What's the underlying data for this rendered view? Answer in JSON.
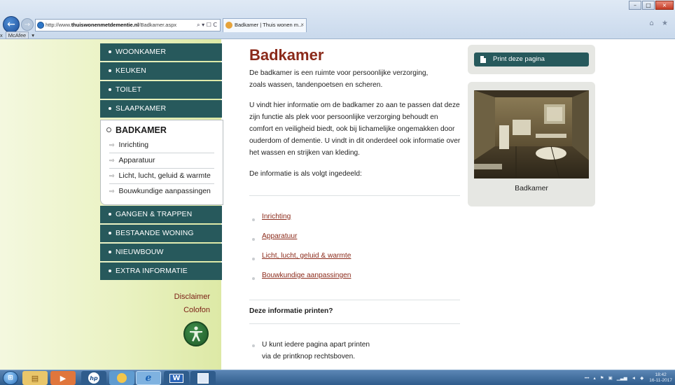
{
  "browser": {
    "url_prefix": "http://www.",
    "url_domain": "thuiswonenmetdementie.nl",
    "url_path": "/Badkamer.aspx",
    "address_tools": "⌕ ▾ ☐ C",
    "tab_title": "Badkamer | Thuis wonen m...",
    "tab_close": "×",
    "toolbar_close": "x",
    "toolbar_mcafee": "McAfee",
    "window_buttons": [
      "–",
      "□",
      "×"
    ],
    "home_star": "⌂ ★"
  },
  "sidebar": {
    "menu_top": [
      "WOONKAMER",
      "KEUKEN",
      "TOILET",
      "SLAAPKAMER"
    ],
    "active_section": "BADKAMER",
    "submenu": [
      "Inrichting",
      "Apparatuur",
      "Licht, lucht, geluid & warmte",
      "Bouwkundige aanpassingen"
    ],
    "menu_bottom": [
      "GANGEN & TRAPPEN",
      "BESTAANDE WONING",
      "NIEUWBOUW",
      "EXTRA INFORMATIE"
    ],
    "disclaimer": "Disclaimer",
    "colofon": "Colofon"
  },
  "content": {
    "title": "Badkamer",
    "intro": "De badkamer is een ruimte voor persoonlijke verzorging, zoals wassen, tandenpoetsen en scheren.",
    "body": "U vindt hier informatie om de badkamer zo aan te passen dat deze zijn functie als plek voor persoonlijke verzorging behoudt en comfort en veiligheid biedt, ook bij lichamelijke ongemakken door ouderdom of dementie. U vindt in dit onderdeel ook informatie over het wassen en strijken van kleding.",
    "index_intro": "De informatie is als volgt ingedeeld:",
    "links": [
      "Inrichting",
      "Apparatuur",
      "Licht, lucht, geluid & warmte",
      "Bouwkundige aanpassingen"
    ],
    "print_heading": "Deze informatie printen?",
    "print_text": "U kunt iedere pagina apart printen via de printknop rechtsboven."
  },
  "aside": {
    "print_button": "Print deze pagina",
    "photo_caption": "Badkamer"
  },
  "taskbar": {
    "word_label": "W",
    "time": "18:42",
    "date": "16-11-2017"
  },
  "colors": {
    "menu_teal": "#27595c",
    "title_red": "#8b2a1a",
    "sidebar_green": "#eaf2c2"
  }
}
